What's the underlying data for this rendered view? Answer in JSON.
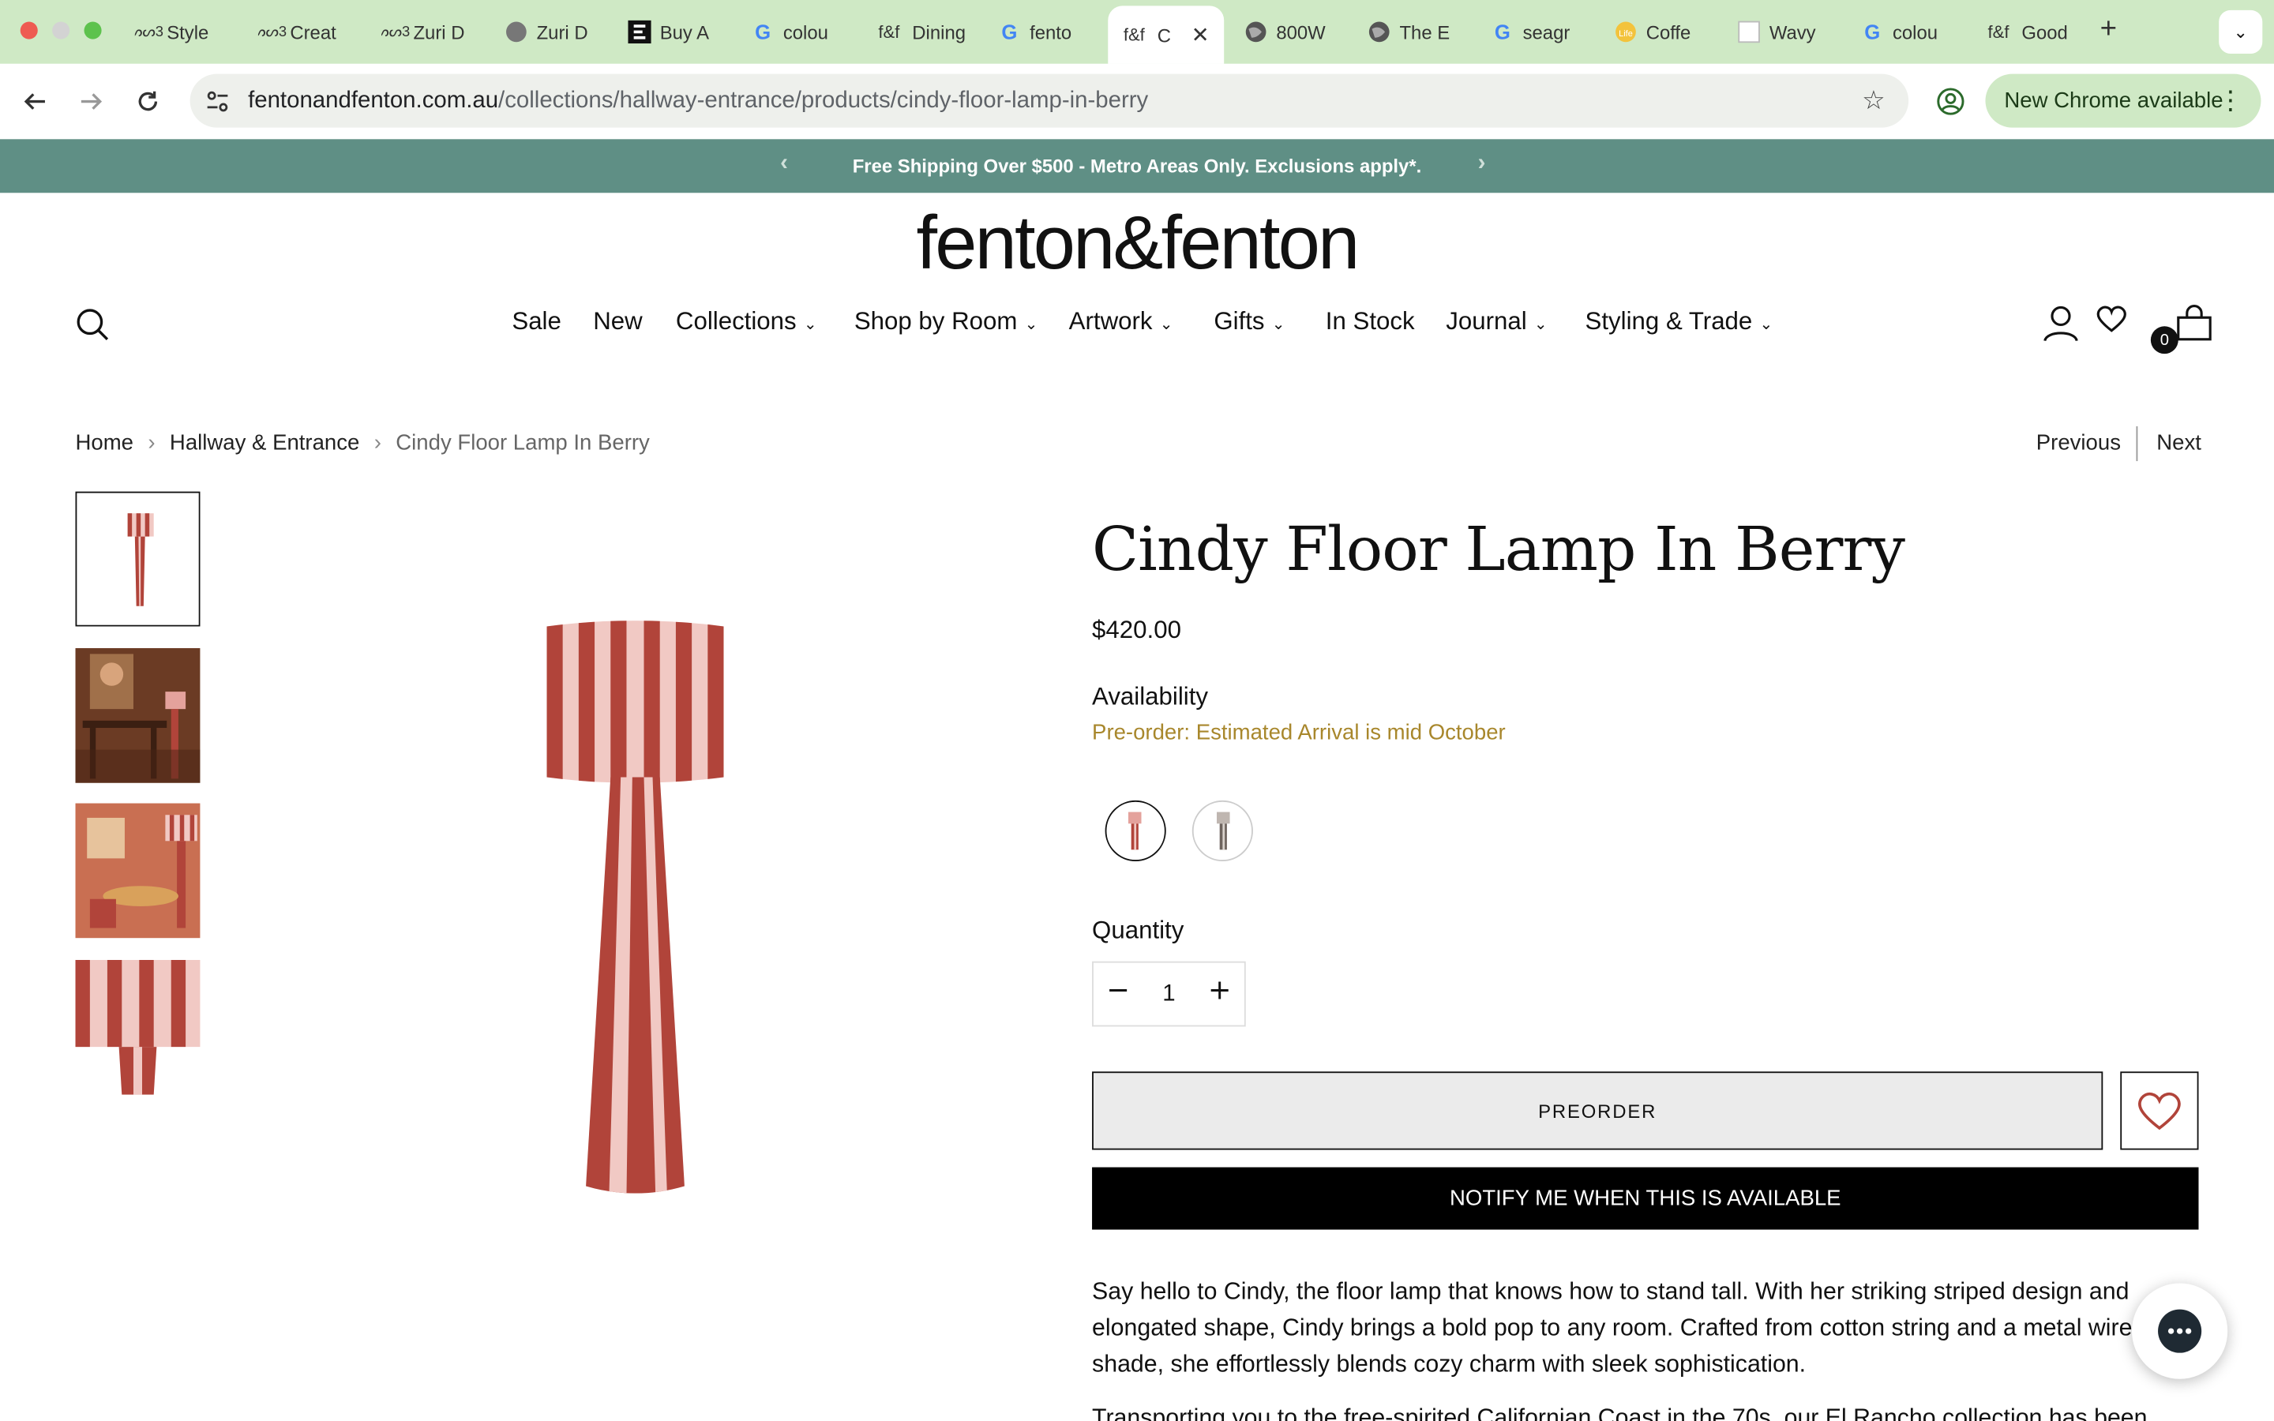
{
  "browser": {
    "tabs": [
      {
        "label": "Style",
        "icon": "ss3-icon"
      },
      {
        "label": "Creat",
        "icon": "ss3-icon"
      },
      {
        "label": "Zuri D",
        "icon": "ss3-icon"
      },
      {
        "label": "Zuri D",
        "icon": "zuri-icon"
      },
      {
        "label": "Buy A",
        "icon": "e-icon"
      },
      {
        "label": "colou",
        "icon": "google-icon"
      },
      {
        "label": "Dining",
        "icon": "ff-icon"
      },
      {
        "label": "fento",
        "icon": "google-icon"
      },
      {
        "label": "C",
        "icon": "ff-icon"
      },
      {
        "label": "800W",
        "icon": "globe-icon"
      },
      {
        "label": "The E",
        "icon": "globe-icon"
      },
      {
        "label": "seagr",
        "icon": "google-icon"
      },
      {
        "label": "Coffe",
        "icon": "life-icon"
      },
      {
        "label": "Wavy",
        "icon": "blank-icon"
      },
      {
        "label": "colou",
        "icon": "google-icon"
      },
      {
        "label": "Good",
        "icon": "ff-icon"
      }
    ],
    "favicon_ff": "f&f",
    "favicon_life": "Life",
    "url_domain": "fentonandfenton.com.au",
    "url_path": "/collections/hallway-entrance/products/cindy-floor-lamp-in-berry",
    "new_chrome": "New Chrome available",
    "accent": "#cfe9c5"
  },
  "announcement": {
    "text": "Free Shipping Over $500 - Metro Areas Only. Exclusions apply*.",
    "color": "#5f8f85"
  },
  "header": {
    "logo": "fenton&fenton",
    "nav": [
      "Sale",
      "New",
      "Collections",
      "Shop by Room",
      "Artwork",
      "Gifts",
      "In Stock",
      "Journal",
      "Styling & Trade"
    ],
    "cart_count": "0"
  },
  "breadcrumb": {
    "home": "Home",
    "category": "Hallway & Entrance",
    "current": "Cindy Floor Lamp In Berry",
    "previous": "Previous",
    "next": "Next"
  },
  "product": {
    "title": "Cindy Floor Lamp In Berry",
    "price": "$420.00",
    "availability_label": "Availability",
    "availability": "Pre-order: Estimated Arrival is mid October",
    "quantity_label": "Quantity",
    "quantity": "1",
    "preorder_label": "PREORDER",
    "notify_label": "NOTIFY ME WHEN THIS IS AVAILABLE",
    "description": "Say hello to Cindy, the floor lamp that knows how to stand tall. With her striking striped design and elongated shape, Cindy brings a bold pop to any room. Crafted from cotton string and a metal wire shade, she effortlessly blends cozy charm with sleek sophistication.",
    "description_2": "Transporting you to the free-spirited Californian Coast in the 70s, our El Rancho collection has been",
    "colors": {
      "berry": "#b1443a",
      "pink": "#f1c9c4",
      "availability": "#a8872c"
    }
  }
}
